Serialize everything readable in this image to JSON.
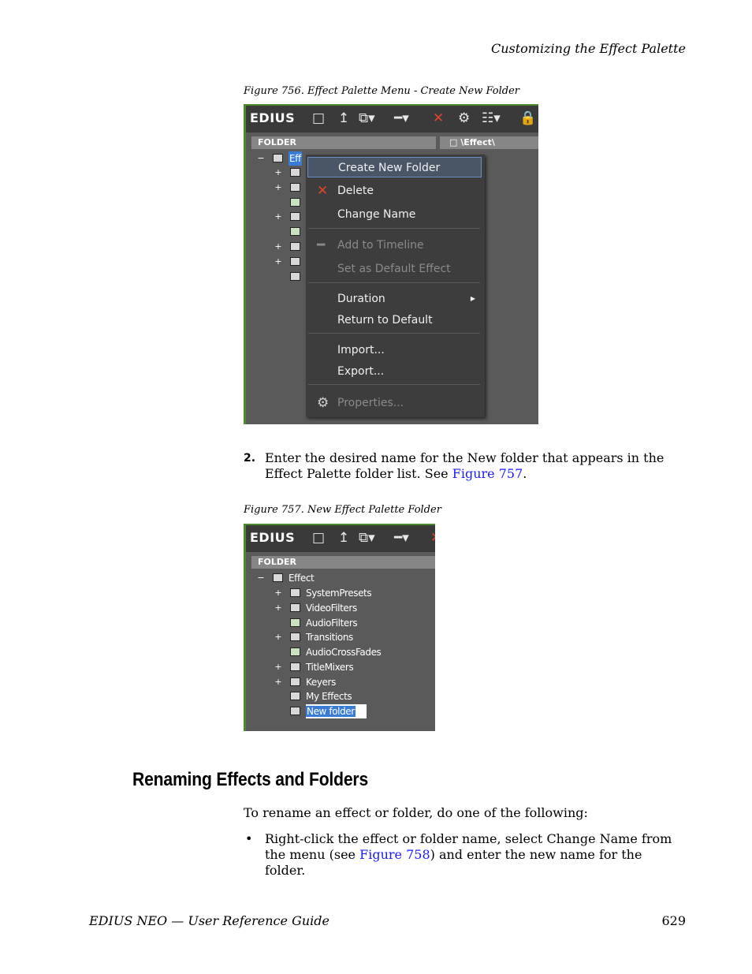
{
  "header": {
    "section_title": "Customizing the Effect Palette"
  },
  "figure756": {
    "caption": "Figure 756.  Effect Palette Menu - Create New Folder",
    "app_logo": "EDIUS",
    "toolbar_icons": [
      "folder-icon",
      "up-arrow-icon",
      "folder-copy-icon",
      "add-to-timeline-icon",
      "delete-icon",
      "properties-icon",
      "view-mode-icon",
      "lock-icon"
    ],
    "folder_header": "FOLDER",
    "path_header": "\\Effect\\",
    "tree_root_label": "Eff",
    "menu_items": {
      "create_new_folder": "Create New Folder",
      "delete": "Delete",
      "change_name": "Change Name",
      "add_to_timeline": "Add to Timeline",
      "set_as_default": "Set as Default Effect",
      "duration": "Duration",
      "return_to_default": "Return to Default",
      "import": "Import...",
      "export": "Export...",
      "properties": "Properties..."
    }
  },
  "step2": {
    "number": "2.",
    "text_before": "Enter the desired name for the New folder that appears in the Effect Palette folder list. See ",
    "link": "Figure 757",
    "text_after": "."
  },
  "figure757": {
    "caption": "Figure 757.  New Effect Palette Folder",
    "app_logo": "EDIUS",
    "folder_header": "FOLDER",
    "tree": {
      "root": "Effect",
      "items": [
        "SystemPresets",
        "VideoFilters",
        "AudioFilters",
        "Transitions",
        "AudioCrossFades",
        "TitleMixers",
        "Keyers",
        "My Effects",
        "New folder"
      ]
    }
  },
  "section": {
    "heading": "Renaming Effects and Folders",
    "intro": "To rename an effect or folder, do one of the following:",
    "bullet_before": "Right-click the effect or folder name, select Change Name from the menu (see ",
    "bullet_link": "Figure 758",
    "bullet_after": ") and enter the new name for the folder."
  },
  "footer": {
    "guide_title": "EDIUS NEO  —  User Reference Guide",
    "page_number": "629"
  }
}
